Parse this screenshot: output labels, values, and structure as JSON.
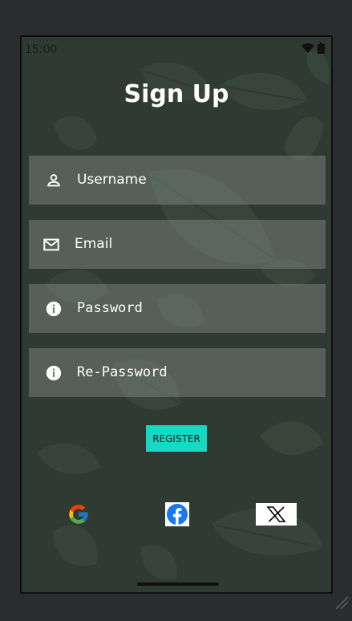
{
  "status_bar": {
    "time": "15:00",
    "icons": [
      "wifi-icon",
      "battery-icon"
    ]
  },
  "title": "Sign Up",
  "fields": {
    "username": {
      "placeholder": "Username",
      "icon": "person-icon"
    },
    "email": {
      "placeholder": "Email",
      "icon": "mail-icon"
    },
    "password": {
      "placeholder": "Password",
      "icon": "info-icon"
    },
    "re_password": {
      "placeholder": "Re-Password",
      "icon": "info-icon"
    }
  },
  "register_button": {
    "label": "REGISTER"
  },
  "social": {
    "google": {
      "label": "G",
      "icon": "google-icon"
    },
    "facebook": {
      "label": "f",
      "icon": "facebook-icon"
    },
    "x": {
      "label": "X",
      "icon": "x-icon"
    }
  },
  "colors": {
    "background": "#2f3a32",
    "field": "#6f7a72",
    "accent": "#16d9c4",
    "text": "#ffffff"
  }
}
